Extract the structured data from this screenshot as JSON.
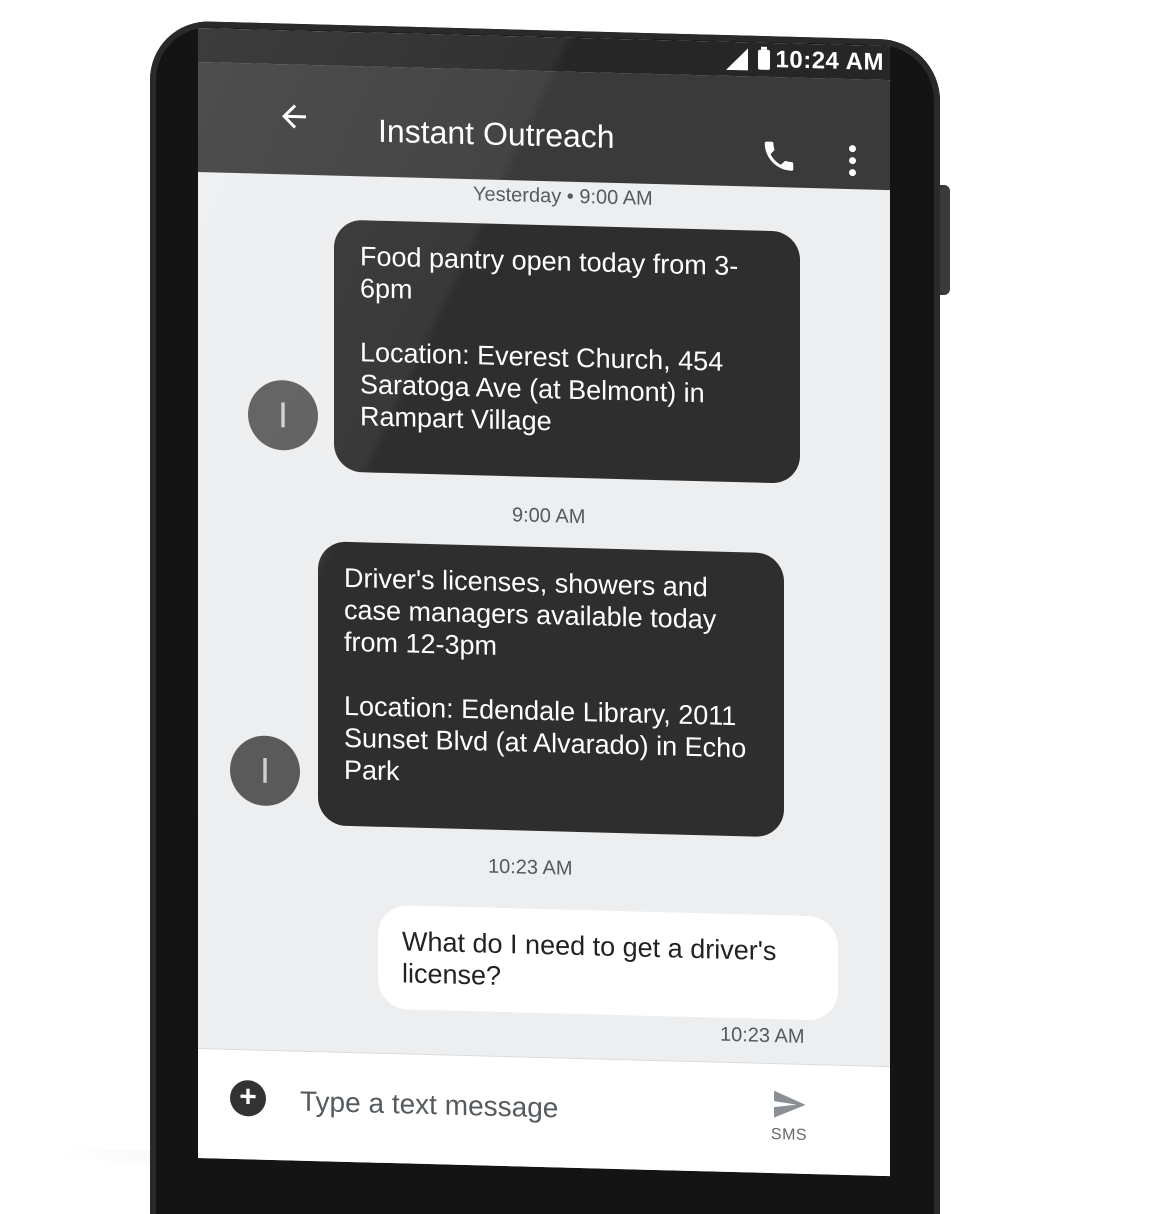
{
  "status_bar": {
    "time": "10:24 AM",
    "icons": [
      "signal-icon",
      "battery-icon"
    ]
  },
  "app_bar": {
    "title": "Instant Outreach",
    "icons": [
      "back-arrow-icon",
      "phone-icon",
      "more-vert-icon"
    ]
  },
  "conversation": {
    "messages": [
      {
        "timestamp": "Yesterday • 9:00 AM",
        "direction": "incoming",
        "avatar_initial": "I",
        "paragraphs": [
          "Food pantry open today from 3-6pm",
          "Location: Everest Church, 454 Saratoga Ave (at Belmont) in Rampart Village"
        ]
      },
      {
        "timestamp": "9:00 AM",
        "direction": "incoming",
        "avatar_initial": "I",
        "paragraphs": [
          "Driver's licenses, showers and case managers available today from 12-3pm",
          "Location: Edendale Library, 2011 Sunset Blvd (at Alvarado) in Echo Park"
        ]
      },
      {
        "timestamp": "10:23 AM",
        "direction": "outgoing",
        "text": "What do I need to get a driver's license?",
        "sent_time": "10:23 AM"
      }
    ]
  },
  "compose": {
    "placeholder": "Type a text message",
    "send_label": "SMS",
    "icons": [
      "add-circle-icon",
      "send-icon"
    ]
  },
  "colors": {
    "app_bar": "#3a3a3a",
    "incoming_bubble": "#2e2e2e",
    "outgoing_bubble": "#ffffff",
    "screen_bg": "#eceef0"
  }
}
